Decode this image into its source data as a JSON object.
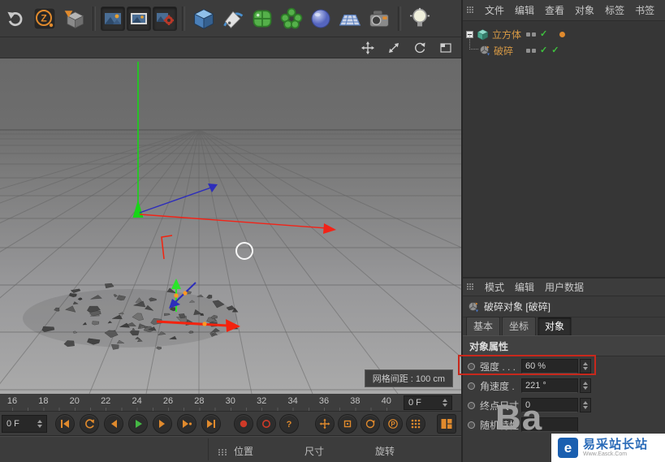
{
  "toolbar": {
    "icons": [
      "undo",
      "z-badge",
      "make-editable",
      "render-view",
      "render-picture-viewer",
      "render-settings",
      "cube-primitive",
      "spline-pen",
      "subdivision-surface",
      "array",
      "metaball",
      "floor",
      "camera",
      "light"
    ]
  },
  "viewport_header": {
    "nav_icons": [
      "pan",
      "zoom",
      "rotate",
      "maximize"
    ]
  },
  "viewport": {
    "grid_spacing_label": "网格间距 : 100 cm"
  },
  "object_manager": {
    "menu": [
      "文件",
      "编辑",
      "查看",
      "对象",
      "标签",
      "书签"
    ],
    "objects": [
      {
        "name": "立方体"
      },
      {
        "name": "破碎"
      }
    ]
  },
  "attribute_manager": {
    "menu": [
      "模式",
      "编辑",
      "用户数据"
    ],
    "object_title": "破碎对象 [破碎]",
    "tabs": [
      {
        "label": "基本"
      },
      {
        "label": "坐标"
      },
      {
        "label": "对象"
      }
    ],
    "active_tab": "对象",
    "section_title": "对象属性",
    "properties": [
      {
        "label": "强度 . . .",
        "value": "60 %",
        "highlighted": true
      },
      {
        "label": "角速度 .",
        "value": "221 °",
        "highlighted": false
      },
      {
        "label": "终点尺寸",
        "value": "0",
        "highlighted": false
      },
      {
        "label": "随机特性",
        "value": "",
        "highlighted": false
      }
    ]
  },
  "timeline": {
    "ticks": [
      "16",
      "18",
      "20",
      "22",
      "24",
      "26",
      "28",
      "30",
      "32",
      "34",
      "36",
      "38",
      "40"
    ],
    "frame_field": "0 F"
  },
  "transport": {
    "frame_field": "0 F"
  },
  "coordinate_bar": {
    "columns": [
      "位置",
      "尺寸",
      "旋转"
    ]
  },
  "watermark": {
    "big_text": "Ba",
    "site_name": "易采站长站",
    "site_url": "Www.Easck.Com"
  },
  "colors": {
    "accent_orange": "#e08a2d",
    "selection_text": "#d89a45",
    "highlight_red": "#c8281c",
    "check_green": "#3ec23e",
    "play_green": "#44b844"
  }
}
